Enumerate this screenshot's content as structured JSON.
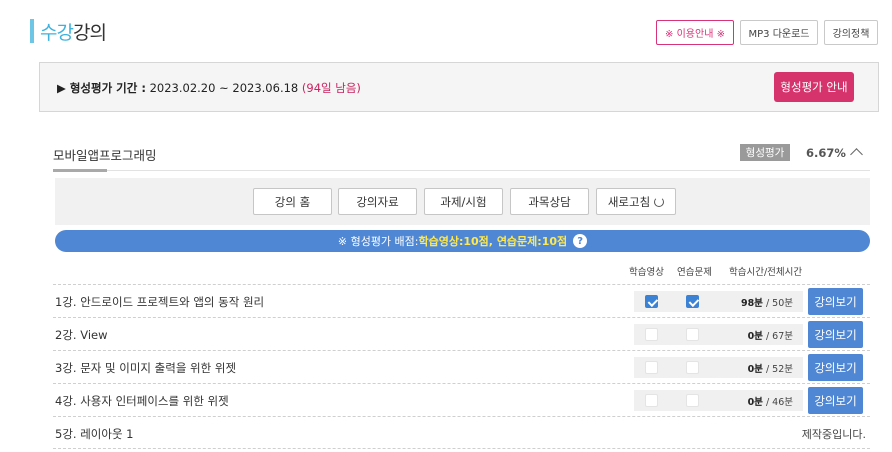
{
  "header": {
    "title_accent": "수강",
    "title_rest": "강의",
    "buttons": {
      "rest_info": "※ 이용안내 ※",
      "mp3_download": "MP3 다운로드",
      "lecture_policy": "강의정책"
    }
  },
  "evaluation_period": {
    "label": "▶ 형성평가 기간 :",
    "range": " 2023.02.20 ~ 2023.06.18 ",
    "remaining": "(94일 남음)",
    "guide_button": "형성평가 안내"
  },
  "course": {
    "name": "모바일앱프로그래밍",
    "badge": "형성평가",
    "percent": "6.67%"
  },
  "menu": {
    "home": "강의 홈",
    "materials": "강의자료",
    "assignments": "과제/시험",
    "consultation": "과목상담",
    "refresh": "새로고침"
  },
  "score_notice": {
    "prefix": "※ 형성평가 배점: ",
    "highlight": "학습영상:10점, 연습문제:10점",
    "help": "?"
  },
  "columns": {
    "video": "학습영상",
    "practice": "연습문제",
    "time": "학습시간/전체시간"
  },
  "lessons": [
    {
      "title": "1강. 안드로이드 프로젝트와 앱의 동작 원리",
      "video_done": true,
      "practice_done": true,
      "study_time": "98분",
      "total_time": " / 50분",
      "button": "강의보기"
    },
    {
      "title": "2강. View",
      "video_done": false,
      "practice_done": false,
      "study_time": "0분",
      "total_time": " / 67분",
      "button": "강의보기"
    },
    {
      "title": "3강. 문자 및 이미지 출력을 위한 위젯",
      "video_done": false,
      "practice_done": false,
      "study_time": "0분",
      "total_time": " / 52분",
      "button": "강의보기"
    },
    {
      "title": "4강. 사용자 인터페이스를 위한 위젯",
      "video_done": false,
      "practice_done": false,
      "study_time": "0분",
      "total_time": " / 46분",
      "button": "강의보기"
    },
    {
      "title": "5강. 레이아웃 1",
      "status": "제작중입니다."
    }
  ],
  "colors": {
    "accent_blue": "#4f87d4",
    "accent_pink": "#d6336c",
    "title_blue": "#3db2de"
  }
}
